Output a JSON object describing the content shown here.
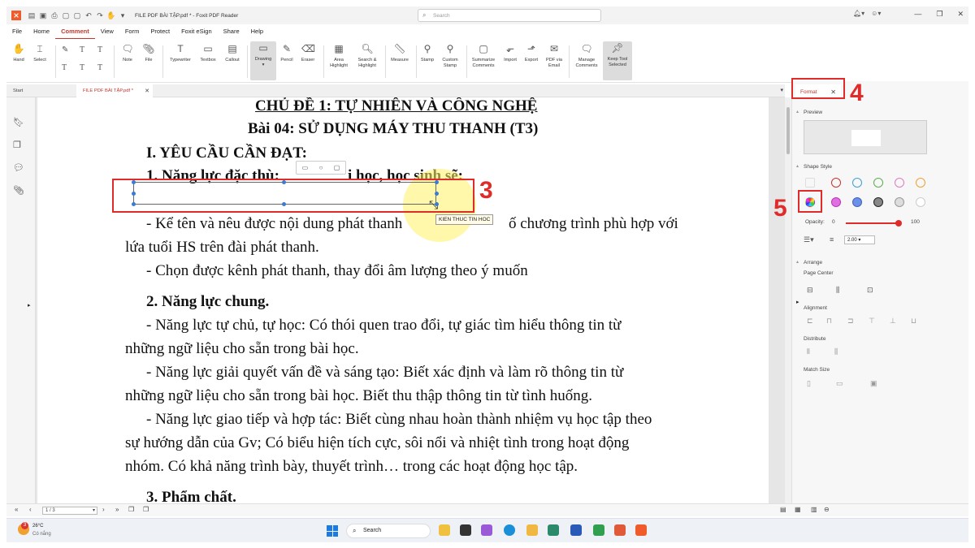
{
  "window": {
    "title": "FILE PDF BÀI TẬP.pdf * - Foxit PDF Reader",
    "search_placeholder": "Search"
  },
  "menu": [
    "File",
    "Home",
    "Comment",
    "View",
    "Form",
    "Protect",
    "Foxit eSign",
    "Share",
    "Help"
  ],
  "ribbon": {
    "hand": "Hand",
    "select": "Select",
    "note": "Note",
    "file": "File",
    "typewriter": "Typewriter",
    "textbox": "Textbox",
    "callout": "Callout",
    "drawing": "Drawing",
    "pencil": "Pencil",
    "eraser": "Eraser",
    "area_highlight": "Area Highlight",
    "search_highlight": "Search & Highlight",
    "measure": "Measure",
    "stamp": "Stamp",
    "custom_stamp": "Custom Stamp",
    "summarize": "Summarize Comments",
    "import": "Import",
    "export": "Export",
    "pdf_email": "PDF via Email",
    "manage": "Manage Comments",
    "keep_tool": "Keep Tool Selected"
  },
  "tabs": {
    "start": "Start",
    "doc": "FILE PDF BÀI TẬP.pdf *"
  },
  "document": {
    "l0": "CHỦ ĐỀ 1: TỰ NHIÊN VÀ CÔNG NGHỆ",
    "l1": "Bài 04: SỬ DỤNG MÁY THU THANH  (T3)",
    "l2": "I. YÊU CẦU CẦN ĐẠT:",
    "l3a": "1. Năng lực đặc thù:",
    "l3b": "i học, học sinh sẽ:",
    "l4a": "- Kể tên và nêu được nội dung phát thanh",
    "l4b": "ố chương trình phù hợp với",
    "l5": "lứa tuổi HS trên đài phát thanh.",
    "l6": "- Chọn được kênh phát thanh, thay đổi âm lượng theo ý muốn",
    "l7": "2. Năng lực chung.",
    "l8": "- Năng lực tự chủ, tự học: Có thói quen trao đổi, tự giác tìm hiểu thông tin từ",
    "l9": "những ngữ liệu cho sẵn trong bài học.",
    "l10": "- Năng lực giải quyết vấn đề và sáng tạo: Biết xác định và làm rõ thông tin từ",
    "l11": "những ngữ liệu cho sẵn trong bài học. Biết thu thập thông tin từ tình huống.",
    "l12": "- Năng lực giao tiếp và hợp tác: Biết cùng nhau hoàn thành nhiệm vụ học tập theo",
    "l13": "sự hướng dẫn của Gv; Có biểu hiện tích cực, sôi nổi và nhiệt tình trong hoạt động",
    "l14": "nhóm. Có khả năng trình bày, thuyết trình… trong các hoạt động học tập.",
    "l15": "3. Phẩm chất."
  },
  "tooltip": "KIEN THUC TIN HOC",
  "callouts": {
    "n3": "3",
    "n4": "4",
    "n5": "5"
  },
  "panel": {
    "tab": "Format",
    "preview": "Preview",
    "shape_style": "Shape Style",
    "opacity": "Opacity:",
    "op_min": "0",
    "op_max": "100",
    "line_width": "2.00",
    "arrange": "Arrange",
    "page_center": "Page Center",
    "alignment": "Alignment",
    "distribute": "Distribute",
    "match_size": "Match Size"
  },
  "status": {
    "page": "1 / 3"
  },
  "weather": {
    "temp": "26°C",
    "desc": "Có nắng",
    "badge": "3"
  },
  "taskbar": {
    "search": "Search"
  },
  "colors": {
    "accent": "#c8342a",
    "highlight": "#e02b2b"
  }
}
